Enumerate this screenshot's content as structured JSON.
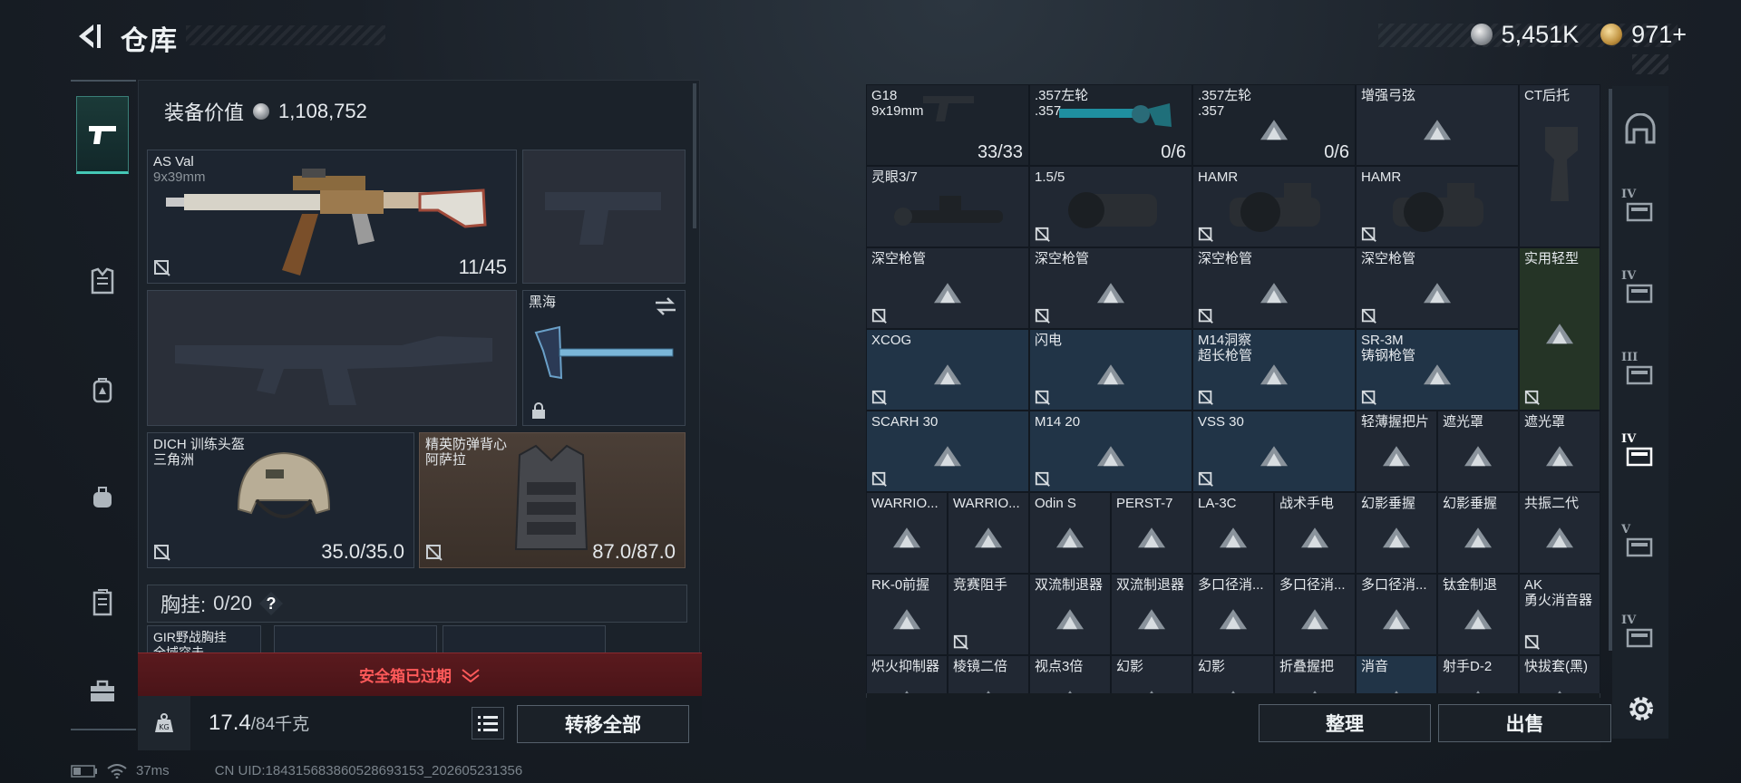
{
  "header": {
    "title": "仓库",
    "silver": "5,451K",
    "gold": "971+"
  },
  "equipment": {
    "value_label": "装备价值",
    "value": "1,108,752",
    "primary": {
      "name": "AS Val",
      "ammo": "9x39mm",
      "count": "11/45"
    },
    "melee": {
      "name": "黑海"
    },
    "helmet": {
      "name": "DICH 训练头盔",
      "sub": "三角洲",
      "durability": "35.0/35.0"
    },
    "armor": {
      "name": "精英防弹背心",
      "sub": "阿萨拉",
      "durability": "87.0/87.0"
    },
    "chest_rig": {
      "label": "胸挂:",
      "count": "0/20",
      "help": "?"
    },
    "rig_item": {
      "name": "GIR野战胸挂",
      "sub": "全域突击"
    },
    "safebox_status": "安全箱已过期"
  },
  "weight": {
    "current": "17.4",
    "max": "/84千克"
  },
  "buttons": {
    "transfer_all": "转移全部",
    "organize": "整理",
    "sell": "出售"
  },
  "status_bar": {
    "ping": "37ms",
    "uid": "CN UID:184315683860528693153_202605231356"
  },
  "right_nav": {
    "tiers": [
      "IV",
      "IV",
      "III",
      "IV",
      "V",
      "IV"
    ]
  },
  "storage": {
    "items": [
      {
        "label": "G18\n9x19mm",
        "count": "33/33"
      },
      {
        "label": ".357左轮\n.357",
        "count": "0/6"
      },
      {
        "label": ".357左轮\n.357",
        "count": "0/6"
      },
      {
        "label": "增强弓弦"
      },
      {
        "label": "CT后托"
      },
      {
        "label": "灵眼3/7"
      },
      {
        "label": "1.5/5"
      },
      {
        "label": "HAMR"
      },
      {
        "label": "HAMR"
      },
      {
        "label": "深空枪管"
      },
      {
        "label": "深空枪管"
      },
      {
        "label": "深空枪管"
      },
      {
        "label": "深空枪管"
      },
      {
        "label": "实用轻型"
      },
      {
        "label": "XCOG"
      },
      {
        "label": "闪电"
      },
      {
        "label": "M14洞察\n超长枪管"
      },
      {
        "label": "SR-3M\n铸钢枪管"
      },
      {
        "label": "SCARH 30"
      },
      {
        "label": "M14 20"
      },
      {
        "label": "VSS 30"
      },
      {
        "label": "轻薄握把片"
      },
      {
        "label": "遮光罩"
      },
      {
        "label": "遮光罩"
      },
      {
        "label": "WARRIO..."
      },
      {
        "label": "WARRIO..."
      },
      {
        "label": "Odin S"
      },
      {
        "label": "PERST-7"
      },
      {
        "label": "LA-3C"
      },
      {
        "label": "战术手电"
      },
      {
        "label": "幻影垂握"
      },
      {
        "label": "幻影垂握"
      },
      {
        "label": "共振二代"
      },
      {
        "label": "RK-0前握"
      },
      {
        "label": "竞赛阻手"
      },
      {
        "label": "双流制退器"
      },
      {
        "label": "双流制退器"
      },
      {
        "label": "多口径消..."
      },
      {
        "label": "多口径消..."
      },
      {
        "label": "多口径消..."
      },
      {
        "label": "钛金制退"
      },
      {
        "label": "AK\n勇火消音器"
      },
      {
        "label": "炽火抑制器"
      },
      {
        "label": "棱镜二倍"
      },
      {
        "label": "视点3倍"
      },
      {
        "label": "幻影"
      },
      {
        "label": "幻影"
      },
      {
        "label": "折叠握把"
      },
      {
        "label": "消音"
      },
      {
        "label": "射手D-2"
      },
      {
        "label": "快拔套(黑)"
      }
    ]
  }
}
